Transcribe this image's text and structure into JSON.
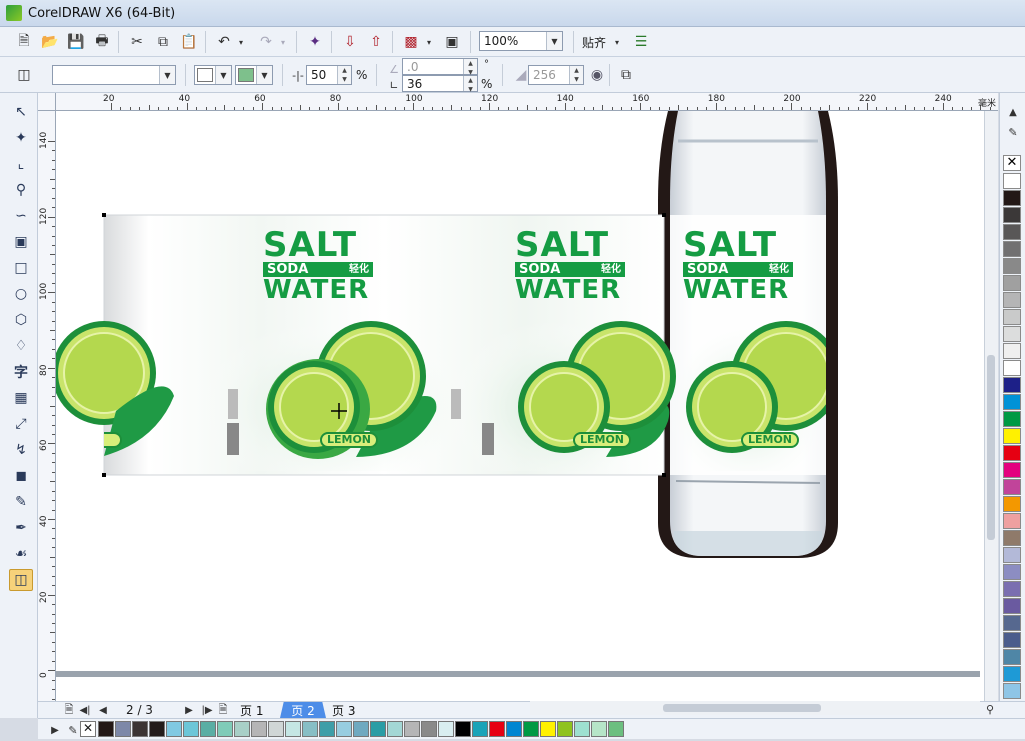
{
  "window": {
    "title": "CorelDRAW X6 (64-Bit)"
  },
  "toolbar": {
    "zoom_value": "100%",
    "snap_label": "贴齐",
    "outline_width_value": "",
    "fill_color": "#7ec08c",
    "transparency_value": "50",
    "percent_sign": "%",
    "angle_value": ".0",
    "degree_sign": "°",
    "edge_value": "36",
    "percent_sign2": "%",
    "bitmap_value": "256"
  },
  "ruler": {
    "unit": "毫米",
    "top_ticks": [
      "20",
      "40",
      "60",
      "80",
      "100",
      "120",
      "140",
      "160",
      "180",
      "200",
      "220",
      "240"
    ],
    "left_ticks": [
      "140",
      "120",
      "100",
      "80",
      "60",
      "40",
      "20",
      "0"
    ]
  },
  "label": {
    "salt": "SALT",
    "soda": "SODA",
    "soda_cn": "轻化",
    "water": "WATER",
    "lemon": "LEMON"
  },
  "pages": {
    "counter": "2 / 3",
    "tabs": [
      "页 1",
      "页 2",
      "页 3"
    ],
    "active_index": 1
  },
  "palette_colors": [
    "#ffffff",
    "#231816",
    "#3b3838",
    "#595757",
    "#717071",
    "#898989",
    "#a0a0a0",
    "#b5b5b6",
    "#c9caca",
    "#dcdddd",
    "#efefef",
    "#ffffff",
    "#1d2088",
    "#0092d7",
    "#009944",
    "#fff100",
    "#e60012",
    "#e4007f",
    "#c1449a",
    "#f39800",
    "#eea0a0",
    "#8f7a6a",
    "#b3b9d8",
    "#8c8dc2",
    "#7a6eb0",
    "#6a5aa0",
    "#56688f",
    "#4b5c8c",
    "#4f86a6",
    "#1e9ad6",
    "#8ec5e6"
  ],
  "docked_colors": [
    "#231816",
    "#7d88a8",
    "#3b3433",
    "#241c1b",
    "#80c9e2",
    "#6cc6d8",
    "#5aaea4",
    "#7fcbb8",
    "#a8cfc7",
    "#b5b5b6",
    "#d0d6d6",
    "#c5e6e4",
    "#87bec5",
    "#3e9ea8",
    "#97cde0",
    "#6fa9c0",
    "#2a9da5",
    "#a3d7d5",
    "#b5b5b6",
    "#8a8a8a",
    "#d9eef0",
    "#000000",
    "#1aa3b8",
    "#e60012",
    "#0086d1",
    "#009944",
    "#fff100",
    "#8fc31f",
    "#9ee0d0",
    "#b6e5c8",
    "#6cbf80"
  ]
}
